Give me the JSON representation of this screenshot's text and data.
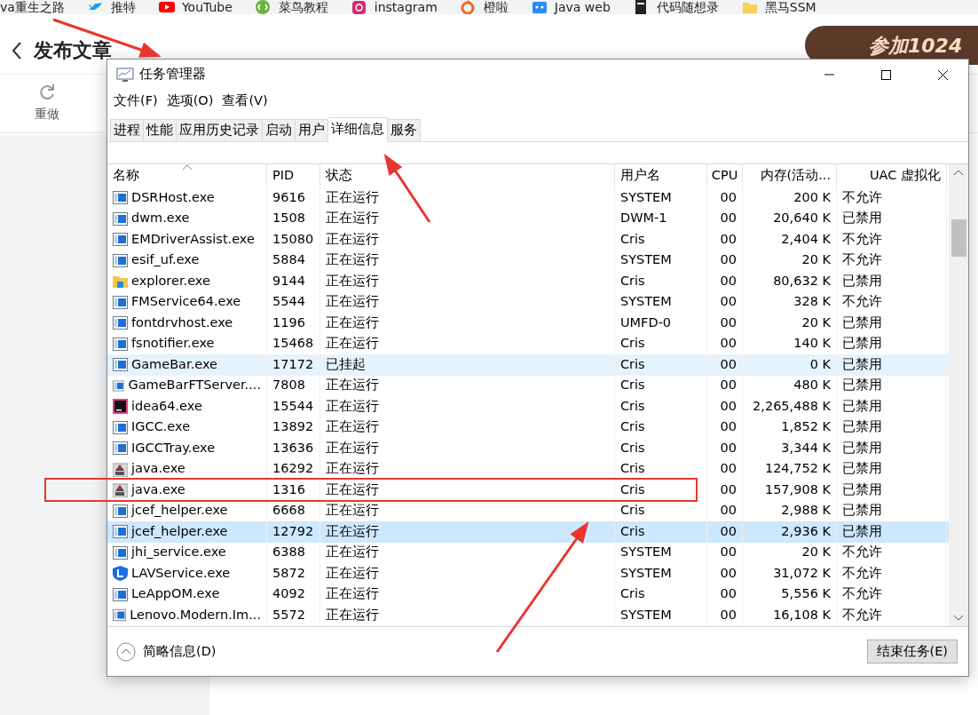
{
  "bookmarks": [
    {
      "label": "va重生之路"
    },
    {
      "label": "推特"
    },
    {
      "label": "YouTube"
    },
    {
      "label": "菜鸟教程"
    },
    {
      "label": "instagram"
    },
    {
      "label": "橙啦"
    },
    {
      "label": "Java web"
    },
    {
      "label": "代码随想录"
    },
    {
      "label": "黑马SSM"
    }
  ],
  "editor": {
    "title": "发布文章",
    "toolbar": [
      {
        "label": "重做"
      }
    ],
    "banner": "参加1024"
  },
  "task_manager": {
    "title": "任务管理器",
    "menu": [
      "文件(F)",
      "选项(O)",
      "查看(V)"
    ],
    "tabs": [
      {
        "label": "进程",
        "selected": false
      },
      {
        "label": "性能",
        "selected": false
      },
      {
        "label": "应用历史记录",
        "selected": false
      },
      {
        "label": "启动",
        "selected": false
      },
      {
        "label": "用户",
        "selected": false
      },
      {
        "label": "详细信息",
        "selected": true
      },
      {
        "label": "服务",
        "selected": false
      }
    ],
    "columns": [
      {
        "label": "名称",
        "sorted": true
      },
      {
        "label": "PID",
        "sorted": false
      },
      {
        "label": "状态",
        "sorted": false
      },
      {
        "label": "用户名",
        "sorted": false
      },
      {
        "label": "CPU",
        "sorted": false
      },
      {
        "label": "内存(活动...",
        "sorted": false
      },
      {
        "label": "UAC 虚拟化",
        "sorted": false
      }
    ],
    "rows": [
      {
        "name": "DSRHost.exe",
        "pid": "9616",
        "status": "正在运行",
        "user": "SYSTEM",
        "cpu": "00",
        "memory": "200 K",
        "uac": "不允许",
        "kind": "app",
        "selected": false,
        "hovered": false,
        "outlined": false
      },
      {
        "name": "dwm.exe",
        "pid": "1508",
        "status": "正在运行",
        "user": "DWM-1",
        "cpu": "00",
        "memory": "20,640 K",
        "uac": "已禁用",
        "kind": "app",
        "selected": false,
        "hovered": false,
        "outlined": false
      },
      {
        "name": "EMDriverAssist.exe",
        "pid": "15080",
        "status": "正在运行",
        "user": "Cris",
        "cpu": "00",
        "memory": "2,404 K",
        "uac": "不允许",
        "kind": "app",
        "selected": false,
        "hovered": false,
        "outlined": false
      },
      {
        "name": "esif_uf.exe",
        "pid": "5884",
        "status": "正在运行",
        "user": "SYSTEM",
        "cpu": "00",
        "memory": "20 K",
        "uac": "不允许",
        "kind": "app",
        "selected": false,
        "hovered": false,
        "outlined": false
      },
      {
        "name": "explorer.exe",
        "pid": "9144",
        "status": "正在运行",
        "user": "Cris",
        "cpu": "00",
        "memory": "80,632 K",
        "uac": "已禁用",
        "kind": "folder",
        "selected": false,
        "hovered": false,
        "outlined": false
      },
      {
        "name": "FMService64.exe",
        "pid": "5544",
        "status": "正在运行",
        "user": "SYSTEM",
        "cpu": "00",
        "memory": "328 K",
        "uac": "不允许",
        "kind": "app",
        "selected": false,
        "hovered": false,
        "outlined": false
      },
      {
        "name": "fontdrvhost.exe",
        "pid": "1196",
        "status": "正在运行",
        "user": "UMFD-0",
        "cpu": "00",
        "memory": "20 K",
        "uac": "已禁用",
        "kind": "app",
        "selected": false,
        "hovered": false,
        "outlined": false
      },
      {
        "name": "fsnotifier.exe",
        "pid": "15468",
        "status": "正在运行",
        "user": "Cris",
        "cpu": "00",
        "memory": "140 K",
        "uac": "已禁用",
        "kind": "app",
        "selected": false,
        "hovered": false,
        "outlined": false
      },
      {
        "name": "GameBar.exe",
        "pid": "17172",
        "status": "已挂起",
        "user": "Cris",
        "cpu": "00",
        "memory": "0 K",
        "uac": "已禁用",
        "kind": "app",
        "selected": false,
        "hovered": true,
        "outlined": false
      },
      {
        "name": "GameBarFTServer....",
        "pid": "7808",
        "status": "正在运行",
        "user": "Cris",
        "cpu": "00",
        "memory": "480 K",
        "uac": "已禁用",
        "kind": "app",
        "selected": false,
        "hovered": false,
        "outlined": false
      },
      {
        "name": "idea64.exe",
        "pid": "15544",
        "status": "正在运行",
        "user": "Cris",
        "cpu": "00",
        "memory": "2,265,488 K",
        "uac": "已禁用",
        "kind": "ide",
        "selected": false,
        "hovered": false,
        "outlined": false
      },
      {
        "name": "IGCC.exe",
        "pid": "13892",
        "status": "正在运行",
        "user": "Cris",
        "cpu": "00",
        "memory": "1,852 K",
        "uac": "已禁用",
        "kind": "app",
        "selected": false,
        "hovered": false,
        "outlined": false
      },
      {
        "name": "IGCCTray.exe",
        "pid": "13636",
        "status": "正在运行",
        "user": "Cris",
        "cpu": "00",
        "memory": "3,344 K",
        "uac": "已禁用",
        "kind": "app",
        "selected": false,
        "hovered": false,
        "outlined": false
      },
      {
        "name": "java.exe",
        "pid": "16292",
        "status": "正在运行",
        "user": "Cris",
        "cpu": "00",
        "memory": "124,752 K",
        "uac": "已禁用",
        "kind": "java",
        "selected": false,
        "hovered": false,
        "outlined": false
      },
      {
        "name": "java.exe",
        "pid": "1316",
        "status": "正在运行",
        "user": "Cris",
        "cpu": "00",
        "memory": "157,908 K",
        "uac": "已禁用",
        "kind": "java",
        "selected": false,
        "hovered": false,
        "outlined": true
      },
      {
        "name": "jcef_helper.exe",
        "pid": "6668",
        "status": "正在运行",
        "user": "Cris",
        "cpu": "00",
        "memory": "2,988 K",
        "uac": "已禁用",
        "kind": "app",
        "selected": false,
        "hovered": false,
        "outlined": false
      },
      {
        "name": "jcef_helper.exe",
        "pid": "12792",
        "status": "正在运行",
        "user": "Cris",
        "cpu": "00",
        "memory": "2,936 K",
        "uac": "已禁用",
        "kind": "app",
        "selected": true,
        "hovered": false,
        "outlined": false
      },
      {
        "name": "jhi_service.exe",
        "pid": "6388",
        "status": "正在运行",
        "user": "SYSTEM",
        "cpu": "00",
        "memory": "20 K",
        "uac": "不允许",
        "kind": "app",
        "selected": false,
        "hovered": false,
        "outlined": false
      },
      {
        "name": "LAVService.exe",
        "pid": "5872",
        "status": "正在运行",
        "user": "SYSTEM",
        "cpu": "00",
        "memory": "31,072 K",
        "uac": "不允许",
        "kind": "shield",
        "selected": false,
        "hovered": false,
        "outlined": false
      },
      {
        "name": "LeAppOM.exe",
        "pid": "4092",
        "status": "正在运行",
        "user": "Cris",
        "cpu": "00",
        "memory": "5,556 K",
        "uac": "不允许",
        "kind": "app",
        "selected": false,
        "hovered": false,
        "outlined": false
      },
      {
        "name": "Lenovo.Modern.Im...",
        "pid": "5572",
        "status": "正在运行",
        "user": "SYSTEM",
        "cpu": "00",
        "memory": "16,108 K",
        "uac": "不允许",
        "kind": "app",
        "selected": false,
        "hovered": false,
        "outlined": false
      }
    ],
    "footer": {
      "toggle": "简略信息(D)",
      "button": "结束任务(E)"
    }
  }
}
